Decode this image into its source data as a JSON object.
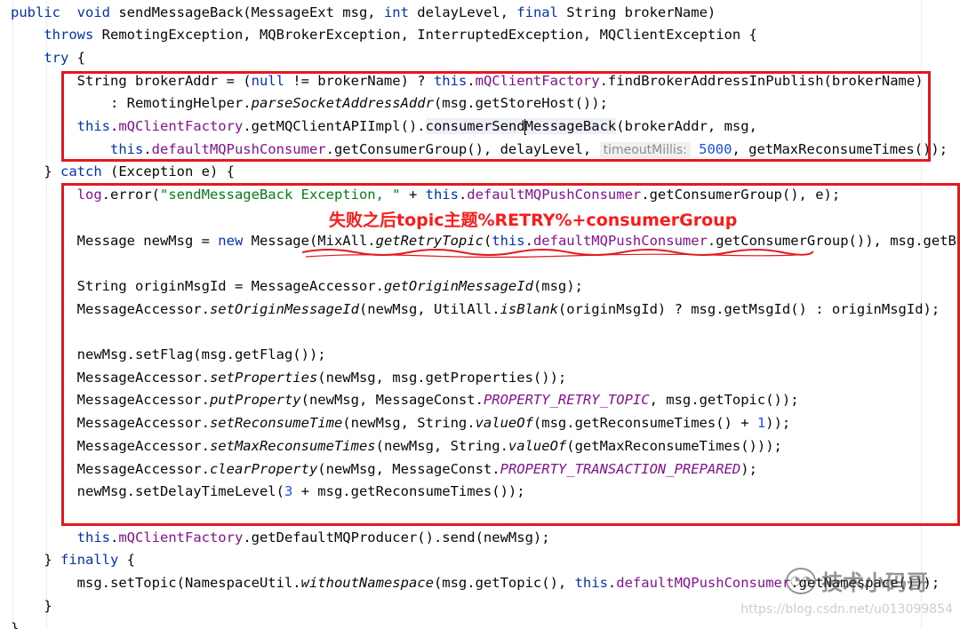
{
  "annotation": {
    "text": "失败之后topic主题%RETRY%+consumerGroup",
    "color": "#ff1a1a"
  },
  "watermark": {
    "brand": "技术小码哥",
    "url": "https://blog.csdn.net/u013099854"
  },
  "colors": {
    "keyword": "#0033b3",
    "field": "#871094",
    "string": "#067d17",
    "number": "#1750eb",
    "highlight_box": "#e3191d"
  },
  "code_lines": [
    [
      [
        "kw",
        "public"
      ],
      [
        "",
        "  "
      ],
      [
        "kw",
        "void"
      ],
      [
        "",
        " sendMessageBack(MessageExt msg, "
      ],
      [
        "kw",
        "int"
      ],
      [
        "",
        " delayLevel, "
      ],
      [
        "kw",
        "final"
      ],
      [
        "",
        " String brokerName)"
      ]
    ],
    [
      [
        "",
        "    "
      ],
      [
        "kw",
        "throws"
      ],
      [
        "",
        " RemotingException, MQBrokerException, InterruptedException, MQClientException {"
      ]
    ],
    [
      [
        "",
        "    "
      ],
      [
        "kw",
        "try"
      ],
      [
        "",
        " {"
      ]
    ],
    [
      [
        "",
        "        String brokerAddr = ("
      ],
      [
        "kw",
        "null"
      ],
      [
        "",
        " != brokerName) ? "
      ],
      [
        "kw",
        "this"
      ],
      [
        "",
        "."
      ],
      [
        "fld",
        "mQClientFactory"
      ],
      [
        "",
        ".findBrokerAddressInPublish(brokerName)"
      ]
    ],
    [
      [
        "",
        "            : RemotingHelper."
      ],
      [
        "it",
        "parseSocketAddressAddr"
      ],
      [
        "",
        "(msg.getStoreHost());"
      ]
    ],
    [
      [
        "",
        "        "
      ],
      [
        "kw",
        "this"
      ],
      [
        "",
        "."
      ],
      [
        "fld",
        "mQClientFactory"
      ],
      [
        "",
        ".getMQClientAPIImpl()."
      ],
      [
        "hl-call",
        "consumerSend"
      ],
      [
        "caret",
        ""
      ],
      [
        "hl-call",
        "MessageBack"
      ],
      [
        "",
        "(brokerAddr, msg,"
      ]
    ],
    [
      [
        "",
        "            "
      ],
      [
        "kw",
        "this"
      ],
      [
        "",
        "."
      ],
      [
        "fld",
        "defaultMQPushConsumer"
      ],
      [
        "",
        ".getConsumerGroup(), delayLevel, "
      ],
      [
        "hint",
        "timeoutMillis:"
      ],
      [
        "",
        " "
      ],
      [
        "num",
        "5000"
      ],
      [
        "",
        ", getMaxReconsumeTimes());"
      ]
    ],
    [
      [
        "",
        "    } "
      ],
      [
        "kw",
        "catch"
      ],
      [
        "",
        " (Exception e) {"
      ]
    ],
    [
      [
        "",
        "        "
      ],
      [
        "fld",
        "log"
      ],
      [
        "",
        ".error("
      ],
      [
        "str",
        "\"sendMessageBack Exception, \""
      ],
      [
        "",
        " + "
      ],
      [
        "kw",
        "this"
      ],
      [
        "",
        "."
      ],
      [
        "fld",
        "defaultMQPushConsumer"
      ],
      [
        "",
        ".getConsumerGroup(), e);"
      ]
    ],
    [],
    [
      [
        "",
        "        Message newMsg = "
      ],
      [
        "kw",
        "new"
      ],
      [
        "",
        " Message(MixAll."
      ],
      [
        "it",
        "getRetryTopic"
      ],
      [
        "",
        "("
      ],
      [
        "kw",
        "this"
      ],
      [
        "",
        "."
      ],
      [
        "fld",
        "defaultMQPushConsumer"
      ],
      [
        "",
        ".getConsumerGroup()), msg.getBody());"
      ]
    ],
    [],
    [
      [
        "",
        "        String originMsgId = MessageAccessor."
      ],
      [
        "it",
        "getOriginMessageId"
      ],
      [
        "",
        "(msg);"
      ]
    ],
    [
      [
        "",
        "        MessageAccessor."
      ],
      [
        "it",
        "setOriginMessageId"
      ],
      [
        "",
        "(newMsg, UtilAll."
      ],
      [
        "it",
        "isBlank"
      ],
      [
        "",
        "(originMsgId) ? msg.getMsgId() : originMsgId);"
      ]
    ],
    [],
    [
      [
        "",
        "        newMsg.setFlag(msg.getFlag());"
      ]
    ],
    [
      [
        "",
        "        MessageAccessor."
      ],
      [
        "it",
        "setProperties"
      ],
      [
        "",
        "(newMsg, msg.getProperties());"
      ]
    ],
    [
      [
        "",
        "        MessageAccessor."
      ],
      [
        "it",
        "putProperty"
      ],
      [
        "",
        "(newMsg, MessageConst."
      ],
      [
        "const",
        "PROPERTY_RETRY_TOPIC"
      ],
      [
        "",
        ", msg.getTopic());"
      ]
    ],
    [
      [
        "",
        "        MessageAccessor."
      ],
      [
        "it",
        "setReconsumeTime"
      ],
      [
        "",
        "(newMsg, String."
      ],
      [
        "it",
        "valueOf"
      ],
      [
        "",
        "(msg.getReconsumeTimes() + "
      ],
      [
        "num",
        "1"
      ],
      [
        "",
        "));"
      ]
    ],
    [
      [
        "",
        "        MessageAccessor."
      ],
      [
        "it",
        "setMaxReconsumeTimes"
      ],
      [
        "",
        "(newMsg, String."
      ],
      [
        "it",
        "valueOf"
      ],
      [
        "",
        "(getMaxReconsumeTimes()));"
      ]
    ],
    [
      [
        "",
        "        MessageAccessor."
      ],
      [
        "it",
        "clearProperty"
      ],
      [
        "",
        "(newMsg, MessageConst."
      ],
      [
        "const",
        "PROPERTY_TRANSACTION_PREPARED"
      ],
      [
        "",
        ");"
      ]
    ],
    [
      [
        "",
        "        newMsg.setDelayTimeLevel("
      ],
      [
        "num",
        "3"
      ],
      [
        "",
        " + msg.getReconsumeTimes());"
      ]
    ],
    [],
    [
      [
        "",
        "        "
      ],
      [
        "kw",
        "this"
      ],
      [
        "",
        "."
      ],
      [
        "fld",
        "mQClientFactory"
      ],
      [
        "",
        ".getDefaultMQProducer().send(newMsg);"
      ]
    ],
    [
      [
        "",
        "    } "
      ],
      [
        "kw",
        "finally"
      ],
      [
        "",
        " {"
      ]
    ],
    [
      [
        "",
        "        msg.setTopic(NamespaceUtil."
      ],
      [
        "it",
        "withoutNamespace"
      ],
      [
        "",
        "(msg.getTopic(), "
      ],
      [
        "kw",
        "this"
      ],
      [
        "",
        "."
      ],
      [
        "fld",
        "defaultMQPushConsumer"
      ],
      [
        "",
        ".getNamespace()));"
      ]
    ],
    [
      [
        "",
        "    }"
      ]
    ],
    [
      [
        "",
        "}"
      ]
    ]
  ]
}
